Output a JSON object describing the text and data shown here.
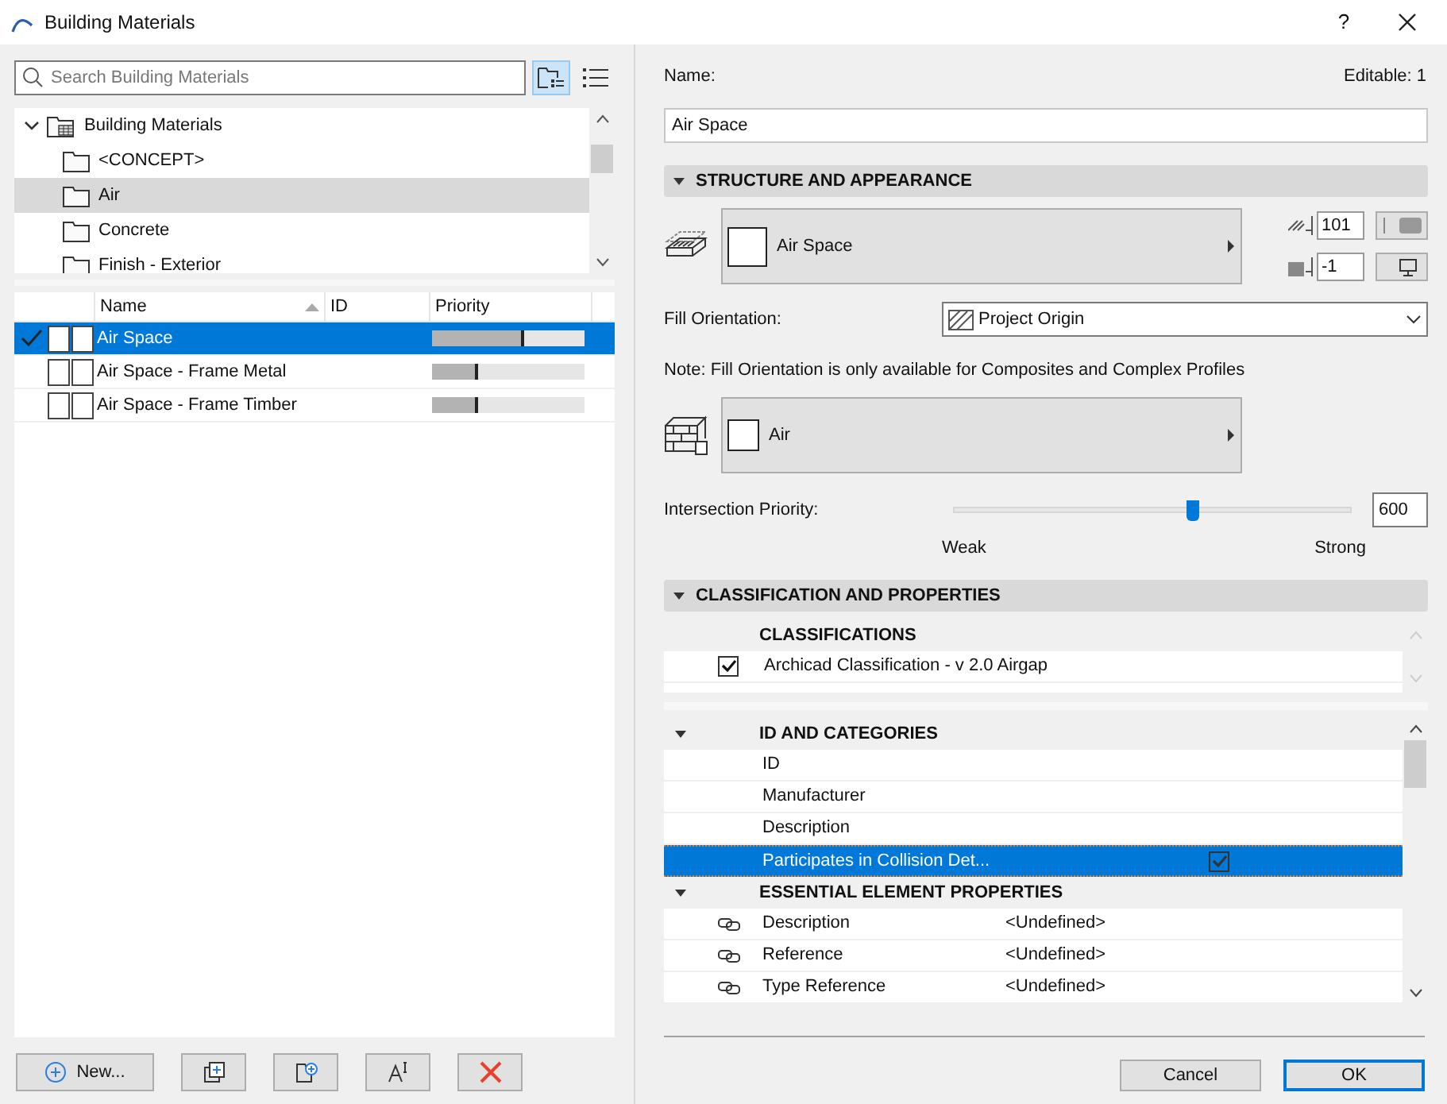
{
  "window": {
    "title": "Building Materials",
    "help": "?"
  },
  "search": {
    "placeholder": "Search Building Materials"
  },
  "view_buttons": [
    {
      "kind": "tree",
      "selected": true
    },
    {
      "kind": "list",
      "selected": false
    }
  ],
  "tree": {
    "label": "Building Materials",
    "expanded": true,
    "children": [
      {
        "label": "<CONCEPT>",
        "selected": false
      },
      {
        "label": "Air",
        "selected": true
      },
      {
        "label": "Concrete",
        "selected": false
      },
      {
        "label": "Finish - Exterior",
        "selected": false
      }
    ]
  },
  "table": {
    "columns": [
      {
        "label": "Name",
        "sorted": true
      },
      {
        "label": "ID",
        "sorted": false
      },
      {
        "label": "Priority",
        "sorted": false
      }
    ],
    "rows": [
      {
        "name": "Air Space",
        "checked": true,
        "selected": true,
        "level": 0.6
      },
      {
        "name": "Air Space - Frame Metal",
        "checked": false,
        "selected": false,
        "level": 0.3
      },
      {
        "name": "Air Space - Frame Timber",
        "checked": false,
        "selected": false,
        "level": 0.3
      }
    ]
  },
  "left_buttons": [
    {
      "kind": "new",
      "label": "New..."
    },
    {
      "kind": "duplicate"
    },
    {
      "kind": "new_folder"
    },
    {
      "kind": "rename"
    },
    {
      "kind": "delete"
    }
  ],
  "name_label": "Name:",
  "editable": "Editable: 1",
  "name_value": "Air Space",
  "structure": {
    "title": "STRUCTURE AND APPEARANCE",
    "expanded": true,
    "surface": "Air Space",
    "cut_fill_pen": "101",
    "background_pen": "-1",
    "fill_orientation_label": "Fill Orientation:",
    "fill_orientation": "Project Origin",
    "note": "Note: Fill Orientation is only available for Composites and Complex Profiles",
    "material": "Air",
    "priority_label": "Intersection Priority:",
    "level": 0.6,
    "priority_value": "600",
    "weak": "Weak",
    "strong": "Strong"
  },
  "classification": {
    "title": "CLASSIFICATION AND PROPERTIES",
    "expanded": true,
    "classifications_title": "CLASSIFICATIONS",
    "classifications": [
      {
        "label": "Archicad Classification - v 2.0 Airgap",
        "checked": true
      }
    ],
    "groups": [
      {
        "title": "ID AND CATEGORIES",
        "expanded": true,
        "rows": [
          {
            "kind": "plain",
            "label": "ID",
            "selected": false
          },
          {
            "kind": "plain",
            "label": "Manufacturer",
            "selected": false
          },
          {
            "kind": "plain",
            "label": "Description",
            "selected": false
          },
          {
            "kind": "check",
            "label": "Participates in Collision Det...",
            "checked": true,
            "selected": true
          }
        ]
      },
      {
        "title": "ESSENTIAL ELEMENT PROPERTIES",
        "expanded": true,
        "rows": [
          {
            "kind": "linked",
            "label": "Description",
            "value": "<Undefined>",
            "selected": false
          },
          {
            "kind": "linked",
            "label": "Reference",
            "value": "<Undefined>",
            "selected": false
          },
          {
            "kind": "linked",
            "label": "Type Reference",
            "value": "<Undefined>",
            "selected": false
          }
        ]
      }
    ]
  },
  "footer_buttons": [
    {
      "label": "Cancel",
      "default": false
    },
    {
      "label": "OK",
      "default": true
    }
  ]
}
